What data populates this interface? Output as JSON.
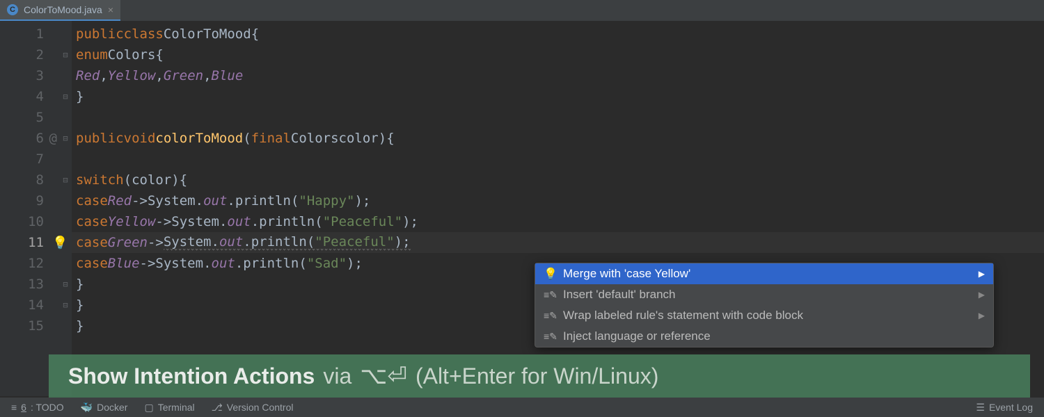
{
  "tab": {
    "filename": "ColorToMood.java",
    "icon_letter": "C"
  },
  "gutter": {
    "line_numbers": [
      "1",
      "2",
      "3",
      "4",
      "5",
      "6",
      "7",
      "8",
      "9",
      "10",
      "11",
      "12",
      "13",
      "14",
      "15"
    ],
    "current_line": 11,
    "at_marker_line": 6
  },
  "code": {
    "l1": {
      "kw1": "public",
      "kw2": "class",
      "name": "ColorToMood",
      "brace": "{"
    },
    "l2": {
      "kw": "enum",
      "name": "Colors",
      "brace": "{"
    },
    "l3": {
      "c1": "Red",
      "c2": "Yellow",
      "c3": "Green",
      "c4": "Blue",
      "comma": ","
    },
    "l4": {
      "brace": "}"
    },
    "l6": {
      "kw1": "public",
      "kw2": "void",
      "method": "colorToMood",
      "open": "(",
      "kw3": "final",
      "type": "Colors",
      "param": "color",
      "close": ")",
      "brace": "{"
    },
    "l8": {
      "kw": "switch",
      "open": "(",
      "var": "color",
      "close": ")",
      "brace": "{"
    },
    "case": {
      "kw": "case",
      "arrow": "->",
      "sys": "System",
      "dot": ".",
      "out": "out",
      "println": "println",
      "open": "(",
      "close": ")",
      "semi": ";"
    },
    "l9": {
      "label": "Red",
      "msg": "\"Happy\""
    },
    "l10": {
      "label": "Yellow",
      "msg": "\"Peaceful\""
    },
    "l11": {
      "label": "Green",
      "msg": "\"Peaceful\""
    },
    "l12": {
      "label": "Blue",
      "msg": "\"Sad\""
    },
    "l13": {
      "brace": "}"
    },
    "l14": {
      "brace": "}"
    },
    "l15": {
      "brace": "}"
    }
  },
  "intentions": {
    "items": [
      "Merge with 'case Yellow'",
      "Insert 'default' branch",
      "Wrap labeled rule's statement with code block",
      "Inject language or reference"
    ]
  },
  "hint": {
    "bold": "Show Intention Actions",
    "via": "via",
    "shortcut_desc": "(Alt+Enter for Win/Linux)"
  },
  "status": {
    "todo_key": "6",
    "todo": ": TODO",
    "docker": "Docker",
    "terminal": "Terminal",
    "vcs": "Version Control",
    "event_log": "Event Log"
  }
}
